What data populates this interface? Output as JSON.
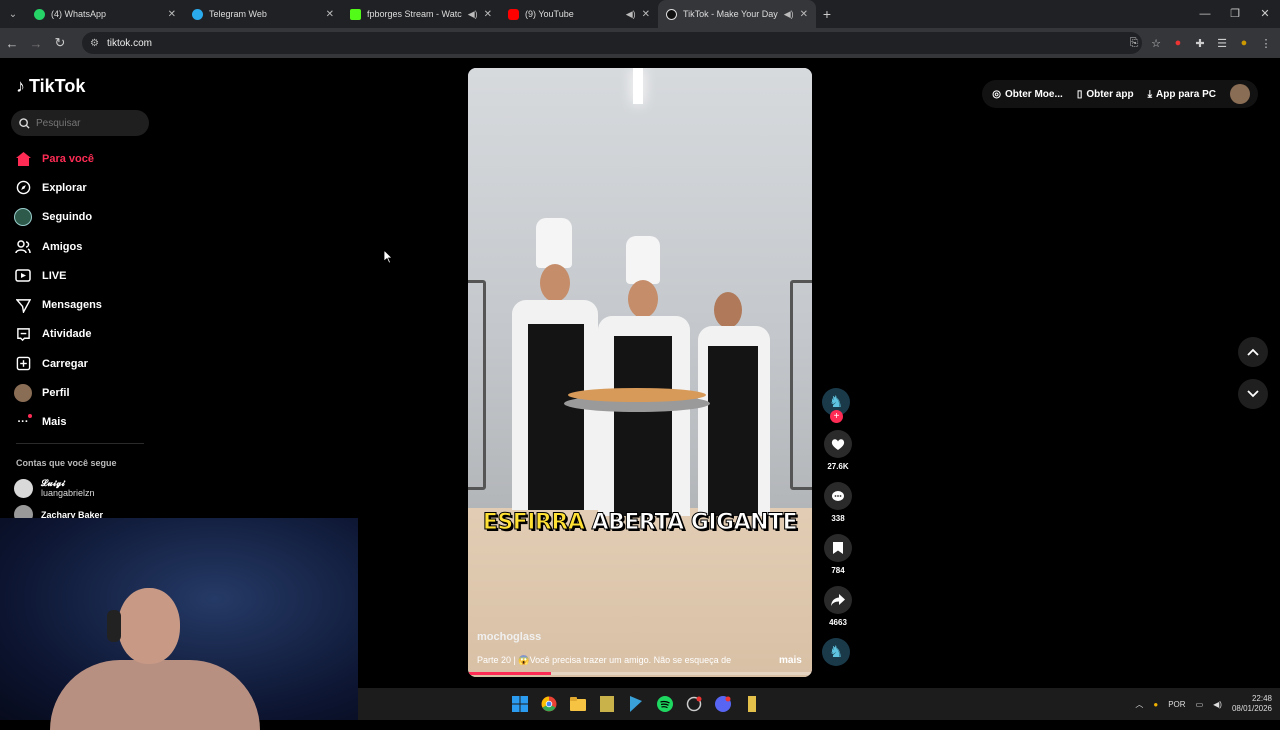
{
  "browser": {
    "tabs": [
      {
        "title": "(4) WhatsApp",
        "icon": "whatsapp-icon",
        "color": "#25d366",
        "speaker": false,
        "active": false
      },
      {
        "title": "Telegram Web",
        "icon": "telegram-icon",
        "color": "#2aabee",
        "speaker": false,
        "active": false
      },
      {
        "title": "fpborges Stream - Watch Li",
        "icon": "kick-icon",
        "color": "#53fc18",
        "speaker": true,
        "active": false
      },
      {
        "title": "(9) YouTube",
        "icon": "youtube-icon",
        "color": "#ff0000",
        "speaker": true,
        "active": false
      },
      {
        "title": "TikTok - Make Your Day",
        "icon": "tiktok-icon",
        "color": "#ffffff",
        "speaker": true,
        "active": true
      }
    ],
    "url": "tiktok.com"
  },
  "tiktok": {
    "logo": "TikTok",
    "search_placeholder": "Pesquisar",
    "nav": [
      {
        "label": "Para você",
        "icon": "home-icon",
        "active": true
      },
      {
        "label": "Explorar",
        "icon": "compass-icon"
      },
      {
        "label": "Seguindo",
        "icon": "following-avatar-icon"
      },
      {
        "label": "Amigos",
        "icon": "friends-icon"
      },
      {
        "label": "LIVE",
        "icon": "live-icon"
      },
      {
        "label": "Mensagens",
        "icon": "messages-icon"
      },
      {
        "label": "Atividade",
        "icon": "activity-icon"
      },
      {
        "label": "Carregar",
        "icon": "upload-icon"
      },
      {
        "label": "Perfil",
        "icon": "profile-avatar-icon"
      },
      {
        "label": "Mais",
        "icon": "more-icon"
      }
    ],
    "following_title": "Contas que você segue",
    "following_accounts": [
      {
        "name": "𝓛𝓾𝓲𝓰𝓲",
        "handle": "luangabrielzn"
      },
      {
        "name": "Zachary Baker",
        "handle": ""
      }
    ],
    "top_right": {
      "coins": "Obter Moe...",
      "app": "Obter app",
      "pc": "App para PC"
    },
    "video": {
      "caption_yellow": "ESFIRRA",
      "caption_white": "ABERTA GIGANTE",
      "author": "mochoglass",
      "description": "Parte 20 | 😱Você precisa trazer um amigo. Não se esqueça de",
      "more": "mais",
      "progress": 0.24
    },
    "actions": {
      "likes": "27.6K",
      "comments": "338",
      "saves": "784",
      "shares": "4663"
    }
  },
  "taskbar": {
    "language": "POR",
    "time": "22:48",
    "date": "08/01/2026"
  },
  "colors": {
    "accent": "#fe2c55",
    "caption_yellow": "#ffe033"
  }
}
